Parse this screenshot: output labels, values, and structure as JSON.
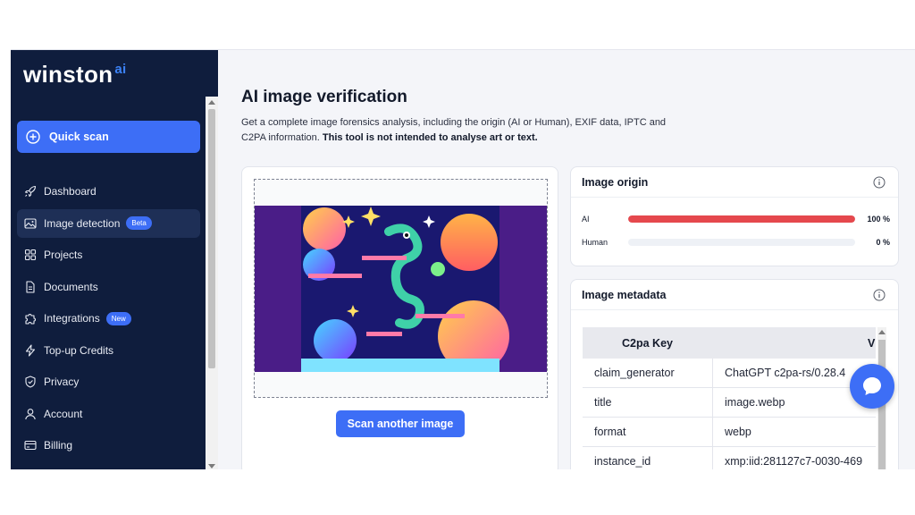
{
  "brand": {
    "name": "winston",
    "suffix": "ai"
  },
  "sidebar": {
    "quick_scan": "Quick scan",
    "items": [
      {
        "label": "Dashboard",
        "icon": "rocket-icon"
      },
      {
        "label": "Image detection",
        "icon": "image-icon",
        "badge": "Beta",
        "active": true
      },
      {
        "label": "Projects",
        "icon": "grid-icon"
      },
      {
        "label": "Documents",
        "icon": "document-icon"
      },
      {
        "label": "Integrations",
        "icon": "puzzle-icon",
        "badge": "New"
      },
      {
        "label": "Top-up Credits",
        "icon": "lightning-icon"
      },
      {
        "label": "Privacy",
        "icon": "shield-icon"
      },
      {
        "label": "Account",
        "icon": "user-icon"
      },
      {
        "label": "Billing",
        "icon": "credit-card-icon"
      }
    ]
  },
  "page": {
    "title": "AI image verification",
    "description": "Get a complete image forensics analysis, including the origin (AI or Human), EXIF data, IPTC and C2PA information.",
    "description_bold": "This tool is not intended to analyse art or text."
  },
  "upload": {
    "button": "Scan another image"
  },
  "origin": {
    "title": "Image origin",
    "rows": [
      {
        "label": "AI",
        "value": "100 %",
        "fraction": 1.0,
        "color": "#e5484d"
      },
      {
        "label": "Human",
        "value": "0 %",
        "fraction": 0.0,
        "color": "#e5484d"
      }
    ]
  },
  "metadata": {
    "title": "Image metadata",
    "columns": [
      "C2pa Key",
      "V"
    ],
    "rows": [
      {
        "key": "claim_generator",
        "value": "ChatGPT c2pa-rs/0.28.4"
      },
      {
        "key": "title",
        "value": "image.webp"
      },
      {
        "key": "format",
        "value": "webp"
      },
      {
        "key": "instance_id",
        "value": "xmp:iid:281127c7-0030-469"
      }
    ]
  },
  "colors": {
    "sidebar": "#0f1d3d",
    "accent": "#3d6ef6",
    "ai_bar": "#e5484d"
  }
}
